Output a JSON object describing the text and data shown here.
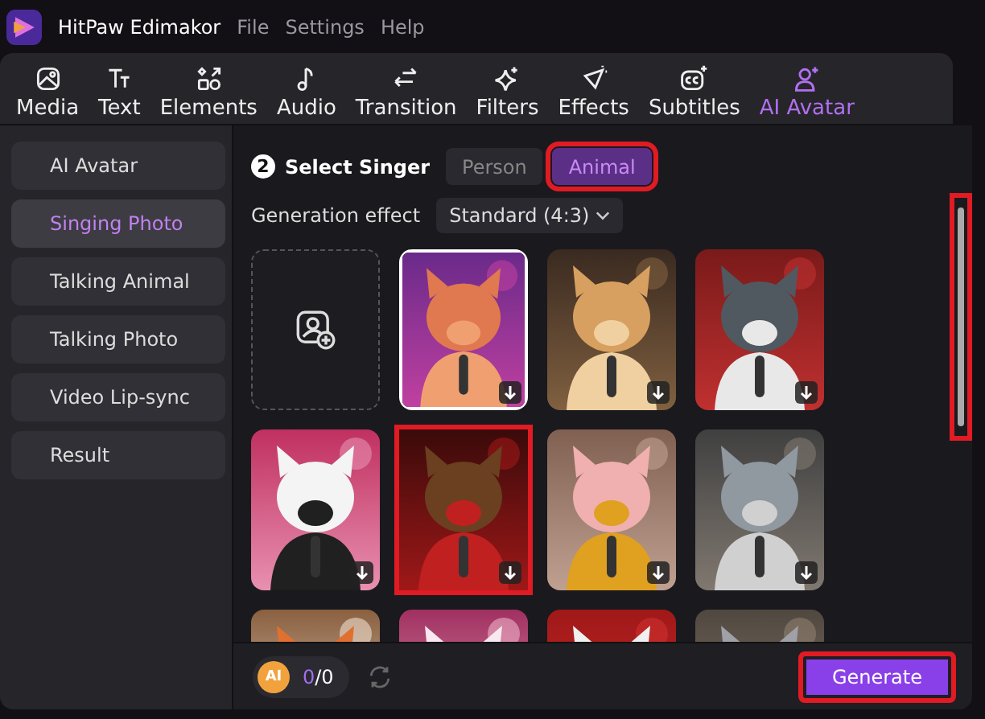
{
  "app": {
    "title": "HitPaw Edimakor",
    "menu": [
      "File",
      "Settings",
      "Help"
    ]
  },
  "toolbar": [
    {
      "label": "Media",
      "selected": false
    },
    {
      "label": "Text",
      "selected": false
    },
    {
      "label": "Elements",
      "selected": false
    },
    {
      "label": "Audio",
      "selected": false
    },
    {
      "label": "Transition",
      "selected": false
    },
    {
      "label": "Filters",
      "selected": false
    },
    {
      "label": "Effects",
      "selected": false
    },
    {
      "label": "Subtitles",
      "selected": false
    },
    {
      "label": "AI Avatar",
      "selected": true
    }
  ],
  "sidebar": {
    "items": [
      {
        "label": "AI Avatar",
        "selected": false
      },
      {
        "label": "Singing Photo",
        "selected": true
      },
      {
        "label": "Talking Animal",
        "selected": false
      },
      {
        "label": "Talking Photo",
        "selected": false
      },
      {
        "label": "Video Lip-sync",
        "selected": false
      },
      {
        "label": "Result",
        "selected": false
      }
    ]
  },
  "step": {
    "number": "2",
    "title": "Select Singer",
    "options": [
      {
        "label": "Person",
        "selected": false,
        "highlighted": false
      },
      {
        "label": "Animal",
        "selected": true,
        "highlighted": true
      }
    ]
  },
  "generation_effect": {
    "label": "Generation effect",
    "value": "Standard (4:3)"
  },
  "gallery": [
    {
      "kind": "upload",
      "selected": false,
      "highlighted": false
    },
    {
      "kind": "picture",
      "selected": true,
      "highlighted": false,
      "download": true
    },
    {
      "kind": "picture",
      "selected": false,
      "highlighted": false,
      "download": true
    },
    {
      "kind": "picture",
      "selected": false,
      "highlighted": false,
      "download": true
    },
    {
      "kind": "picture",
      "selected": false,
      "highlighted": false,
      "download": true
    },
    {
      "kind": "picture",
      "selected": false,
      "highlighted": true,
      "download": true
    },
    {
      "kind": "picture",
      "selected": false,
      "highlighted": false,
      "download": true
    },
    {
      "kind": "picture",
      "selected": false,
      "highlighted": false,
      "download": true
    },
    {
      "kind": "picture",
      "selected": false,
      "highlighted": false
    },
    {
      "kind": "picture",
      "selected": false,
      "highlighted": false
    },
    {
      "kind": "picture",
      "selected": false,
      "highlighted": false
    },
    {
      "kind": "picture",
      "selected": false,
      "highlighted": false
    }
  ],
  "scrollbar_highlighted": true,
  "footer": {
    "coin": "AI",
    "credits_used": "0",
    "credits_rest": "/0",
    "generate": {
      "label": "Generate",
      "highlighted": true
    }
  }
}
